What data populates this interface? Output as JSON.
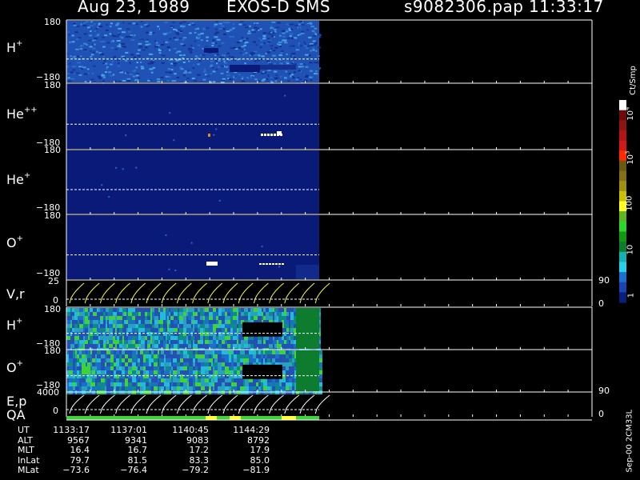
{
  "header": {
    "date": "Aug 23, 1989",
    "instrument": "EXOS-D SMS",
    "file": "s9082306.pap",
    "time": "11:33:17"
  },
  "colors": {
    "background": "#000000",
    "dark_blue": "#0a1a78",
    "medium_blue": "#1f52b4",
    "cyan": "#22bbd8",
    "green": "#3fd23b",
    "yellow": "#ffff33",
    "white": "#ffffff"
  },
  "chart_data": [
    {
      "name": "H+",
      "type": "heatmap",
      "y_ticks": [
        "180",
        "−180"
      ]
    },
    {
      "name": "He++",
      "type": "heatmap",
      "y_ticks": [
        "180",
        "−180"
      ]
    },
    {
      "name": "He+",
      "type": "heatmap",
      "y_ticks": [
        "180",
        "−180"
      ]
    },
    {
      "name": "O+",
      "type": "heatmap",
      "y_ticks": [
        "180",
        "−180"
      ]
    },
    {
      "name": "V,r",
      "type": "line",
      "y_ticks": [
        "25",
        "0"
      ],
      "right_ticks": [
        "90",
        "0"
      ]
    },
    {
      "name": "H+",
      "type": "heatmap",
      "y_ticks": [
        "180",
        "−180"
      ]
    },
    {
      "name": "O+",
      "type": "heatmap",
      "y_ticks": [
        "180",
        "−180"
      ]
    },
    {
      "name": "E,p",
      "type": "line",
      "y_ticks": [
        "4000",
        "0"
      ],
      "right_ticks": [
        "90",
        "0"
      ]
    }
  ],
  "labels": {
    "p1": {
      "main": "H",
      "sup": "+"
    },
    "p2": {
      "main": "He",
      "sup": "++"
    },
    "p3": {
      "main": "He",
      "sup": "+"
    },
    "p4": {
      "main": "O",
      "sup": "+"
    },
    "p5": {
      "main": "V,r",
      "sup": ""
    },
    "p6": {
      "main": "H",
      "sup": "+"
    },
    "p7": {
      "main": "O",
      "sup": "+"
    },
    "p8": {
      "main": "E,p",
      "sup": ""
    },
    "qa": "QA"
  },
  "colorbar": {
    "unit_label": "Ct/Smp",
    "ticks": [
      {
        "base": "10",
        "exp": "4"
      },
      {
        "base": "10",
        "exp": "3"
      },
      {
        "base": "100",
        "exp": ""
      },
      {
        "base": "10",
        "exp": ""
      },
      {
        "base": "1",
        "exp": ""
      }
    ],
    "levels": [
      "#ffffff",
      "#6e0a0a",
      "#8e1414",
      "#b01414",
      "#d01a1a",
      "#ff2a00",
      "#6a5a10",
      "#857018",
      "#a09010",
      "#c8c000",
      "#ffff22",
      "#5cb81c",
      "#2ed42e",
      "#119a11",
      "#0d7c2e",
      "#13b2b2",
      "#25d0e8",
      "#1a6fd2",
      "#1a44b2",
      "#0a1f7c"
    ]
  },
  "table": {
    "rows": [
      {
        "label": "UT",
        "values": [
          "1133:17",
          "1137:01",
          "1140:45",
          "1144:29"
        ]
      },
      {
        "label": "ALT",
        "values": [
          "9567",
          "9341",
          "9083",
          "8792"
        ]
      },
      {
        "label": "MLT",
        "values": [
          "16.4",
          "16.7",
          "17.2",
          "17.9"
        ]
      },
      {
        "label": "InLat",
        "values": [
          "79.7",
          "81.5",
          "83.3",
          "85.0"
        ]
      },
      {
        "label": "MLat",
        "values": [
          "−73.6",
          "−76.4",
          "−79.2",
          "−81.9"
        ]
      }
    ]
  },
  "footer_code": "Sep-00 2CM33L"
}
